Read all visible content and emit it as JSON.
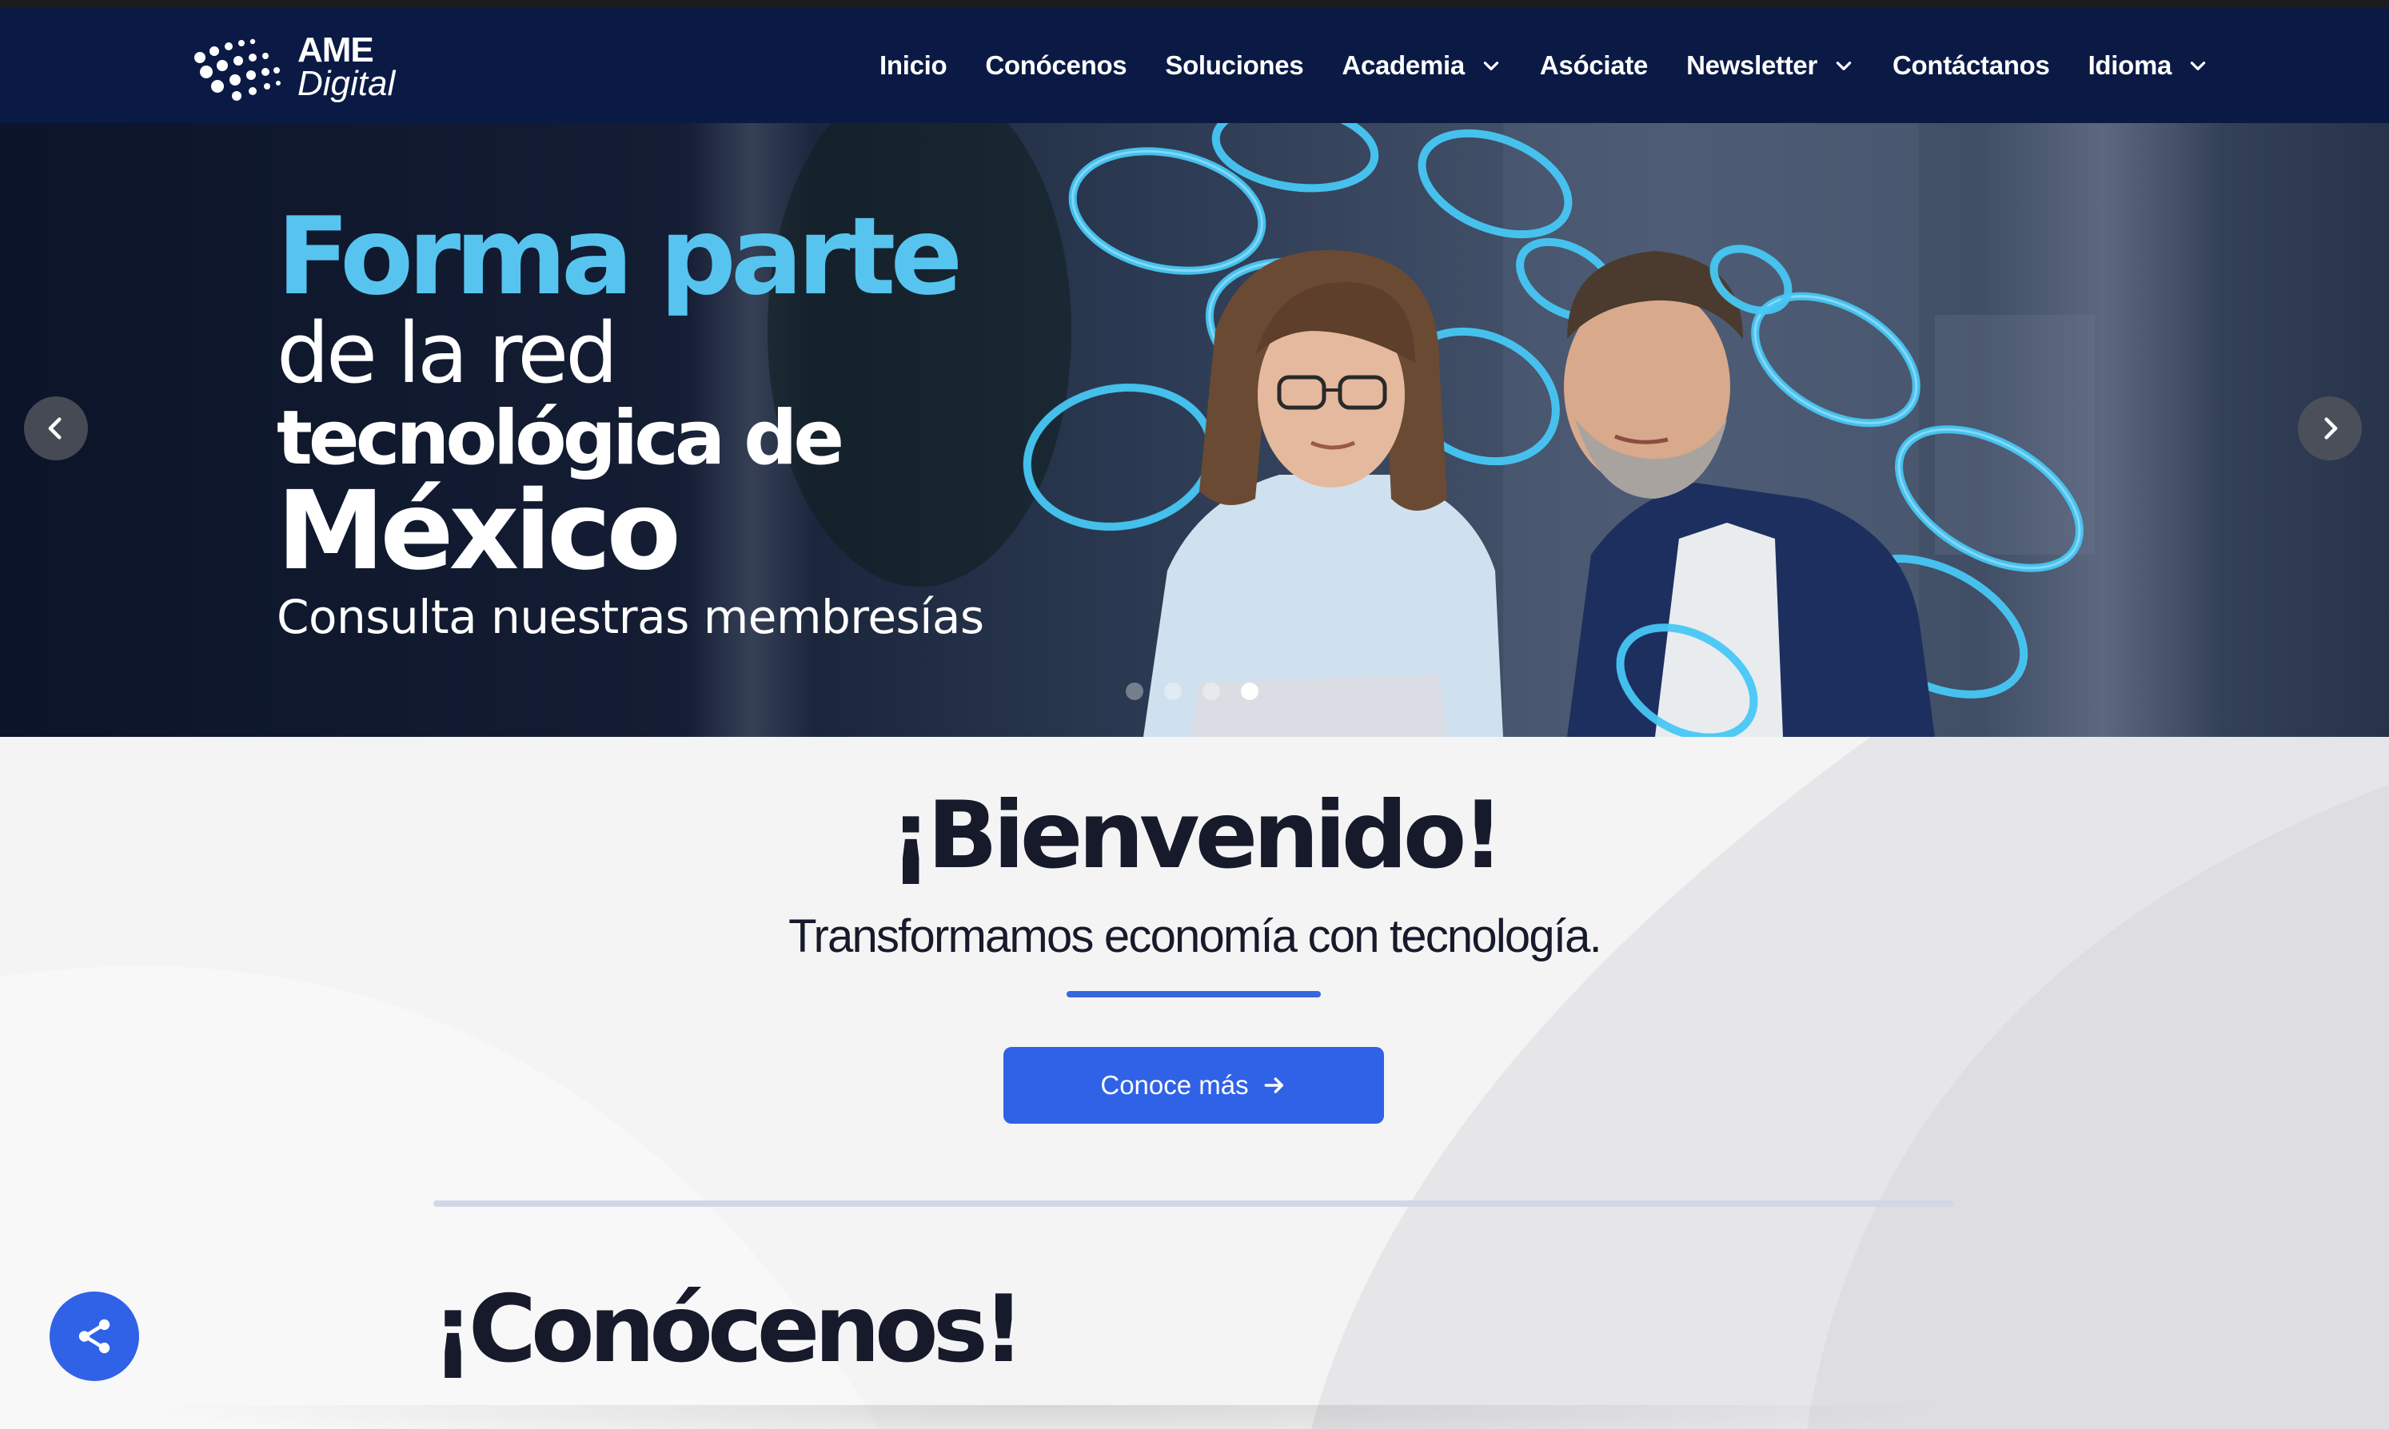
{
  "brand": {
    "line1": "AME",
    "line2": "Digital"
  },
  "nav": {
    "items": [
      {
        "label": "Inicio",
        "dropdown": false
      },
      {
        "label": "Conócenos",
        "dropdown": false
      },
      {
        "label": "Soluciones",
        "dropdown": false
      },
      {
        "label": "Academia",
        "dropdown": true
      },
      {
        "label": "Asóciate",
        "dropdown": false
      },
      {
        "label": "Newsletter",
        "dropdown": true
      },
      {
        "label": "Contáctanos",
        "dropdown": false
      },
      {
        "label": "Idioma",
        "dropdown": true
      }
    ]
  },
  "hero": {
    "line1": "Forma parte",
    "line2": "de la red",
    "line3": "tecnológica de",
    "line4": "México",
    "line5": "Consulta nuestras membresías",
    "slide_count": 4,
    "active_slide": 4,
    "prev_icon": "chevron-left-icon",
    "next_icon": "chevron-right-icon"
  },
  "welcome": {
    "title": "¡Bienvenido!",
    "subtitle": "Transformamos economía con tecnología.",
    "cta_label": "Conoce más"
  },
  "about": {
    "title": "¡Conócenos!"
  },
  "colors": {
    "navbar": "#0a1a45",
    "accent": "#2f62e6",
    "hero_highlight": "#57c4ef",
    "ring": "#3fc4f2"
  },
  "share": {
    "icon": "share-icon"
  }
}
